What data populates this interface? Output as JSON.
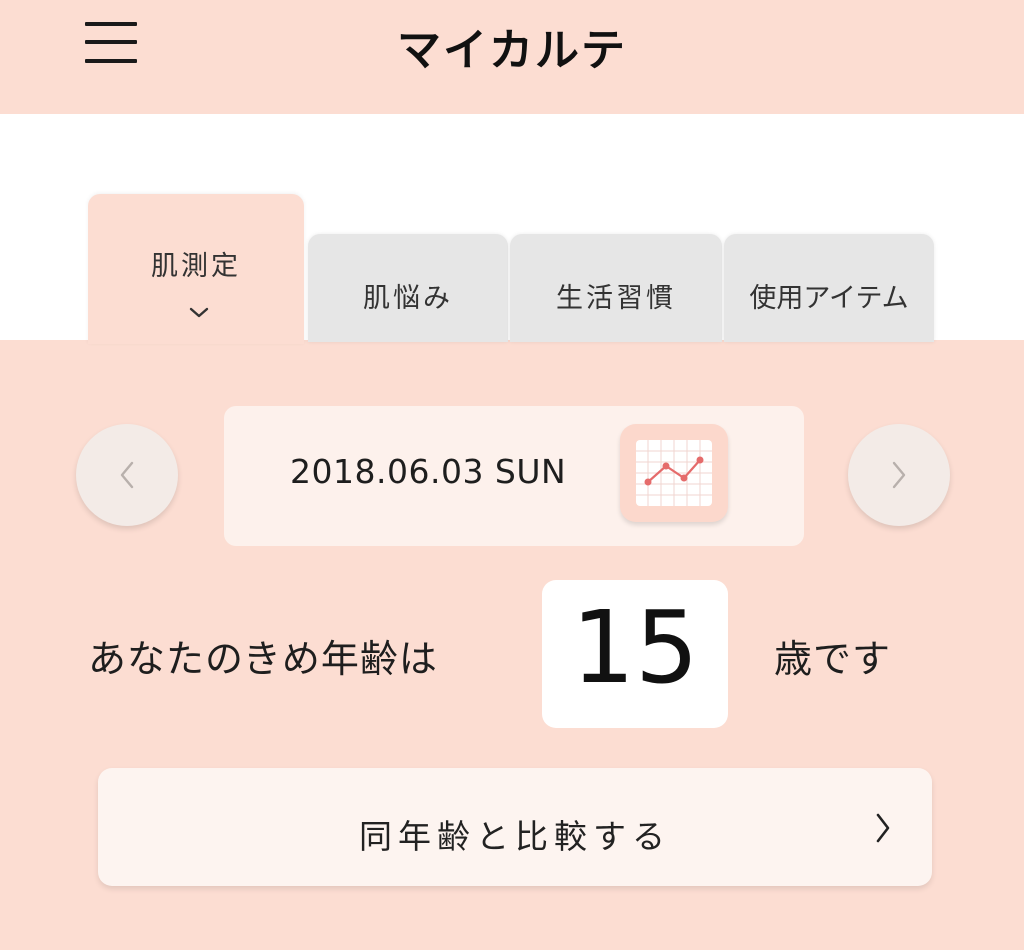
{
  "header": {
    "title": "マイカルテ",
    "menu_icon": "hamburger-menu-icon"
  },
  "tabs": [
    {
      "label": "肌測定",
      "active": true
    },
    {
      "label": "肌悩み",
      "active": false
    },
    {
      "label": "生活習慣",
      "active": false
    },
    {
      "label": "使用アイテム",
      "active": false
    }
  ],
  "date_nav": {
    "date": "2018.06.03 SUN",
    "prev_icon": "chevron-left-icon",
    "next_icon": "chevron-right-icon",
    "graph_icon": "line-graph-icon"
  },
  "age": {
    "label": "あなたのきめ年齢は",
    "value": "15",
    "suffix": "歳です"
  },
  "compare": {
    "label": "同年齢と比較する",
    "icon": "chevron-right-icon"
  },
  "colors": {
    "background": "#fcddd2",
    "tab_inactive": "#e6e6e6",
    "card": "#fdf1ec",
    "graph_line": "#e56b6b"
  }
}
